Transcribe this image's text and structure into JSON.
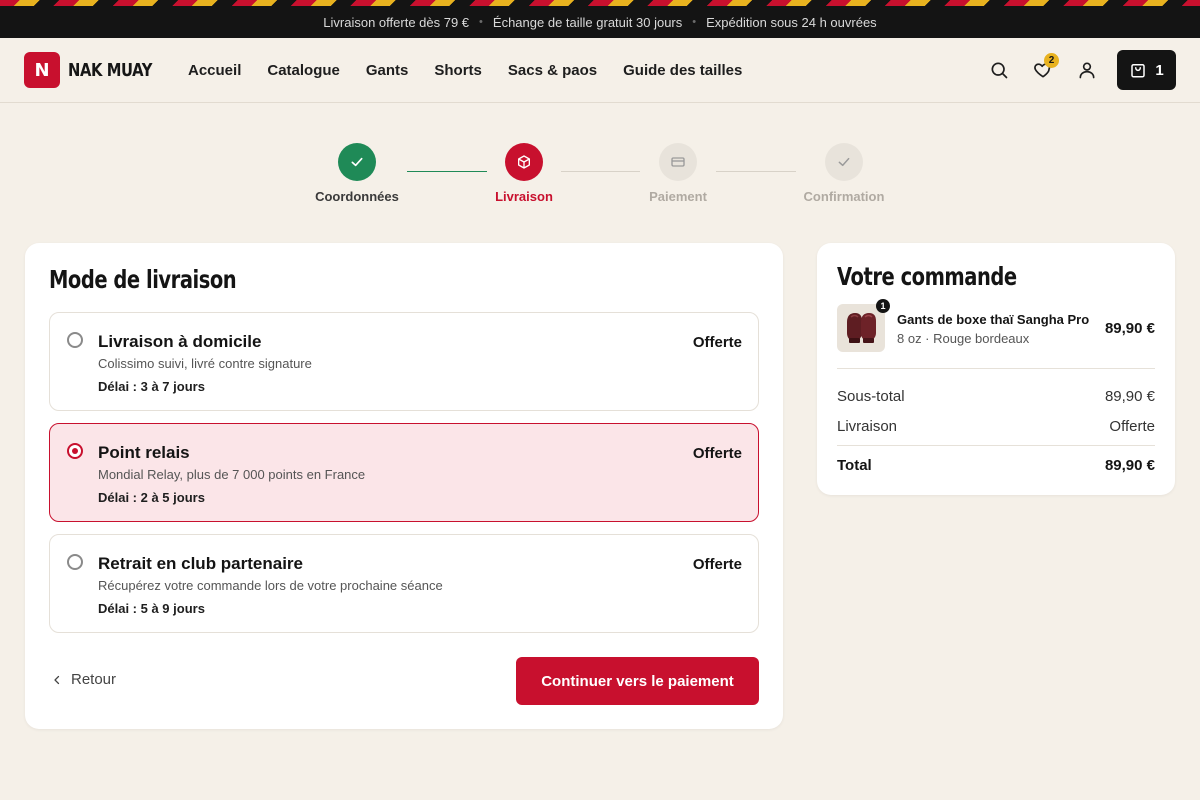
{
  "promo": {
    "messages": [
      "Livraison offerte dès 79 €",
      "Échange de taille gratuit 30 jours",
      "Expédition sous 24 h ouvrées"
    ]
  },
  "header": {
    "logo_letter": "N",
    "logo_text": "NAK MUAY",
    "nav": [
      "Accueil",
      "Catalogue",
      "Gants",
      "Shorts",
      "Sacs & paos",
      "Guide des tailles"
    ],
    "wishlist_count": "2",
    "cart_count": "1"
  },
  "steps": [
    {
      "label": "Coordonnées",
      "state": "done"
    },
    {
      "label": "Livraison",
      "state": "current"
    },
    {
      "label": "Paiement",
      "state": "todo"
    },
    {
      "label": "Confirmation",
      "state": "todo"
    }
  ],
  "shipping": {
    "title": "Mode de livraison",
    "options": [
      {
        "name": "Livraison à domicile",
        "desc": "Colissimo suivi, livré contre signature",
        "delay": "Délai : 3 à 7 jours",
        "price": "Offerte",
        "selected": false
      },
      {
        "name": "Point relais",
        "desc": "Mondial Relay, plus de 7 000 points en France",
        "delay": "Délai : 2 à 5 jours",
        "price": "Offerte",
        "selected": true
      },
      {
        "name": "Retrait en club partenaire",
        "desc": "Récupérez votre commande lors de votre prochaine séance",
        "delay": "Délai : 5 à 9 jours",
        "price": "Offerte",
        "selected": false
      }
    ],
    "back_label": "Retour",
    "continue_label": "Continuer vers le paiement"
  },
  "summary": {
    "title": "Votre commande",
    "item": {
      "name": "Gants de boxe thaï Sangha Pro",
      "variant": "8 oz · Rouge bordeaux",
      "price": "89,90 €",
      "qty": "1"
    },
    "subtotal_label": "Sous-total",
    "subtotal_value": "89,90 €",
    "shipping_label": "Livraison",
    "shipping_value": "Offerte",
    "total_label": "Total",
    "total_value": "89,90 €"
  },
  "colors": {
    "accent": "#c8102e",
    "done": "#1f8a57",
    "dark": "#141414",
    "gold": "#e8b21f",
    "background": "#f5f0e8"
  }
}
